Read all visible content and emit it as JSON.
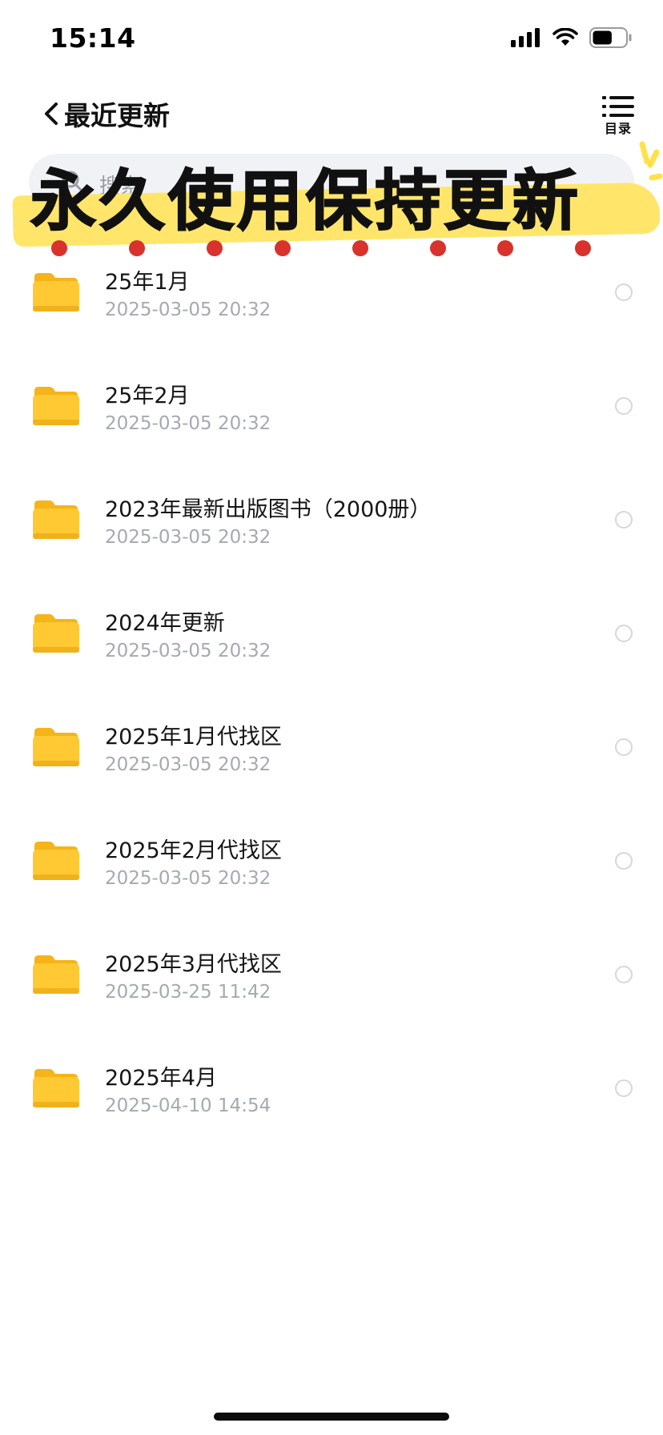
{
  "status_bar": {
    "time": "15:14",
    "battery_level": 0.6
  },
  "nav": {
    "title": "最近更新",
    "toc_label": "目录"
  },
  "search": {
    "placeholder": "搜索"
  },
  "banner": {
    "text": "永久使用保持更新",
    "highlight_color": "#ffe66b",
    "dot_color": "#d9312b"
  },
  "files": [
    {
      "name": "25年1月",
      "date": "2025-03-05 20:32"
    },
    {
      "name": "25年2月",
      "date": "2025-03-05 20:32"
    },
    {
      "name": "2023年最新出版图书（2000册）",
      "date": "2025-03-05 20:32"
    },
    {
      "name": "2024年更新",
      "date": "2025-03-05 20:32"
    },
    {
      "name": "2025年1月代找区",
      "date": "2025-03-05 20:32"
    },
    {
      "name": "2025年2月代找区",
      "date": "2025-03-05 20:32"
    },
    {
      "name": "2025年3月代找区",
      "date": "2025-03-25 11:42"
    },
    {
      "name": "2025年4月",
      "date": "2025-04-10 14:54"
    }
  ],
  "colors": {
    "folder": "#ffc933",
    "date_text": "#a7a9b2"
  }
}
